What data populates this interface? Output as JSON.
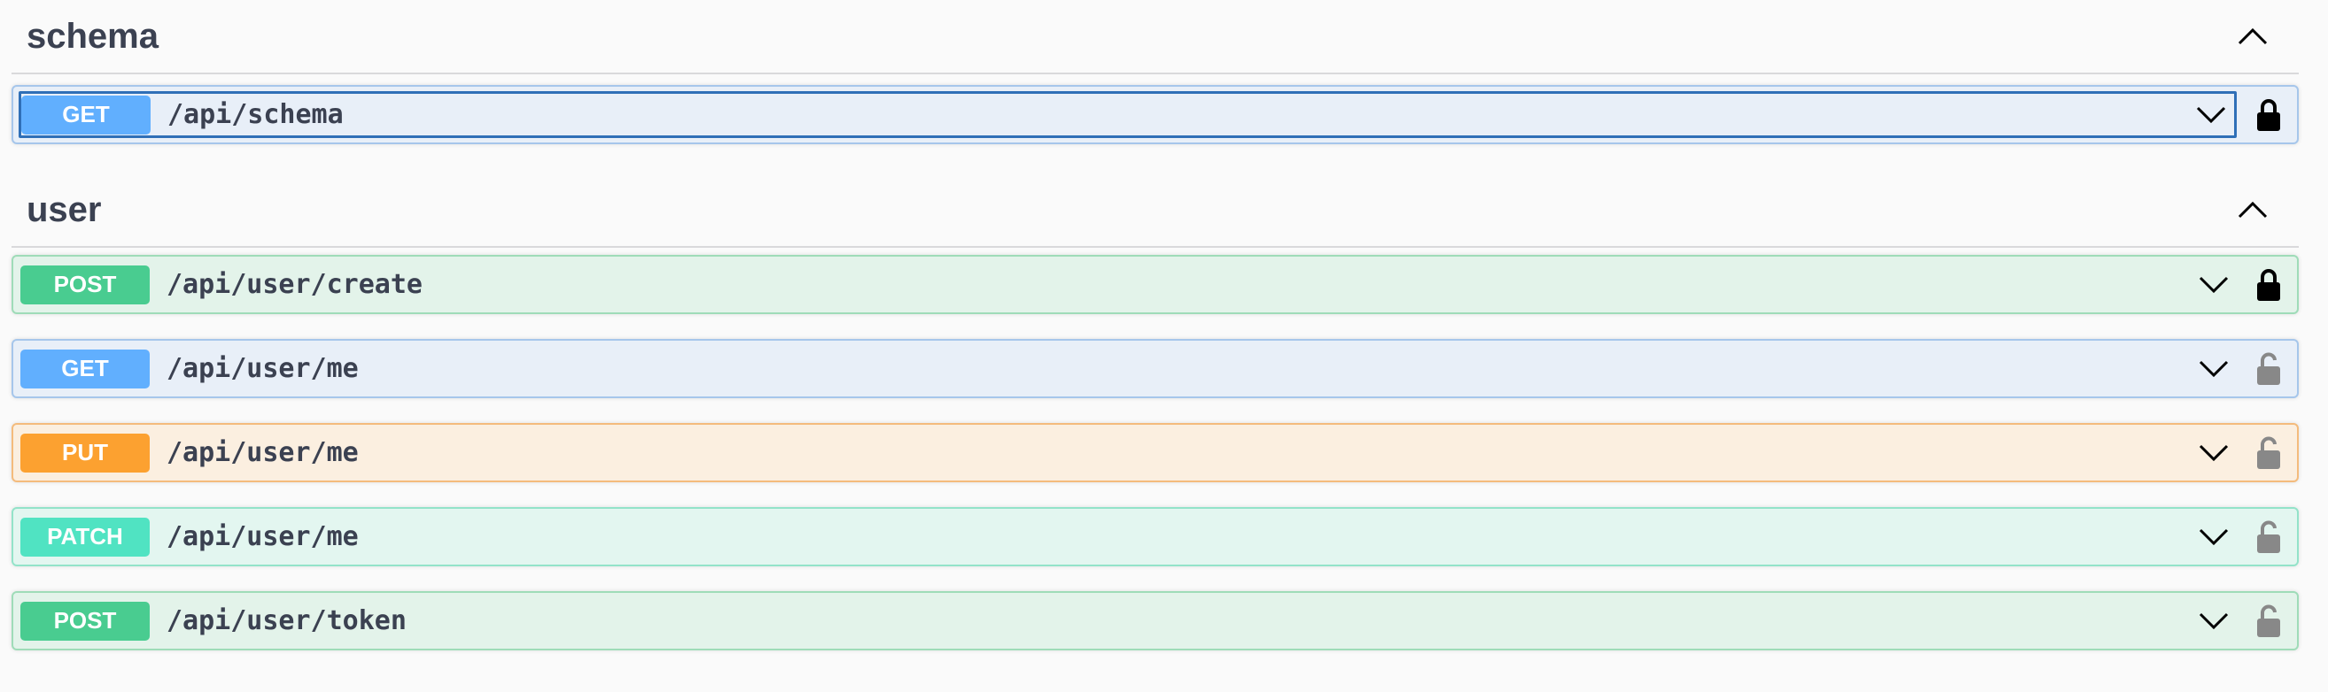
{
  "sections": [
    {
      "title": "schema",
      "operations": [
        {
          "method": "GET",
          "path": "/api/schema",
          "lock": "locked"
        }
      ]
    },
    {
      "title": "user",
      "operations": [
        {
          "method": "POST",
          "path": "/api/user/create",
          "lock": "locked"
        },
        {
          "method": "GET",
          "path": "/api/user/me",
          "lock": "unlocked"
        },
        {
          "method": "PUT",
          "path": "/api/user/me",
          "lock": "unlocked"
        },
        {
          "method": "PATCH",
          "path": "/api/user/me",
          "lock": "unlocked"
        },
        {
          "method": "POST",
          "path": "/api/user/token",
          "lock": "unlocked"
        }
      ]
    }
  ],
  "icons": {
    "collapse": "chevron-up-icon",
    "expand": "chevron-down-icon",
    "locked": "lock-closed-icon",
    "unlocked": "lock-open-icon"
  },
  "colors": {
    "get": "#61affe",
    "post": "#49cc90",
    "put": "#fca130",
    "patch": "#50e3c2"
  }
}
